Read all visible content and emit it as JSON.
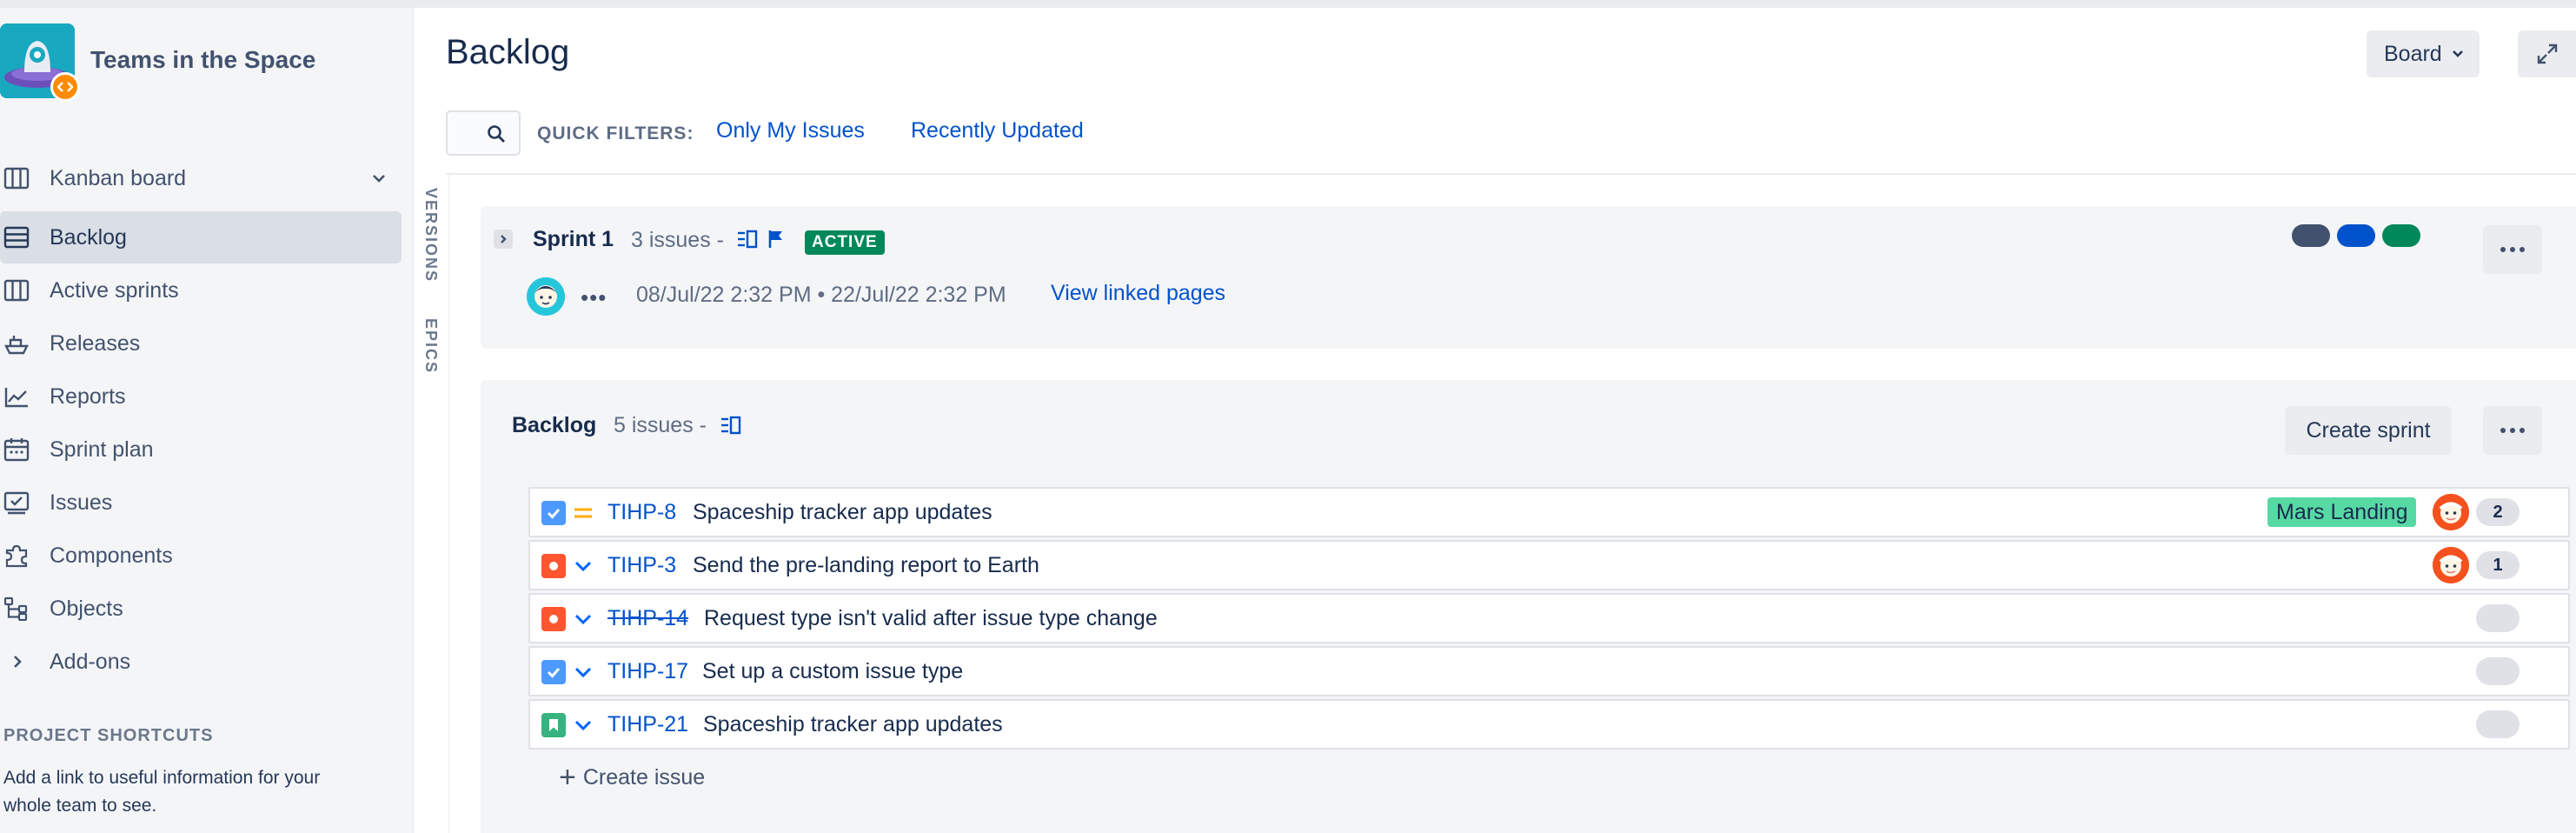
{
  "project": {
    "name": "Teams in the Space"
  },
  "nav": [
    {
      "id": "kanban-board",
      "label": "Kanban board",
      "icon": "board-icon",
      "chevron": "chevron-down-icon"
    },
    {
      "id": "backlog",
      "label": "Backlog",
      "icon": "backlog-icon",
      "active": true
    },
    {
      "id": "active-sprints",
      "label": "Active sprints",
      "icon": "columns-icon"
    },
    {
      "id": "releases",
      "label": "Releases",
      "icon": "ship-icon"
    },
    {
      "id": "reports",
      "label": "Reports",
      "icon": "graph-icon"
    },
    {
      "id": "sprint-plan",
      "label": "Sprint plan",
      "icon": "calendar-icon"
    },
    {
      "id": "issues",
      "label": "Issues",
      "icon": "issues-icon"
    },
    {
      "id": "components",
      "label": "Components",
      "icon": "puzzle-icon"
    },
    {
      "id": "objects",
      "label": "Objects",
      "icon": "hierarchy-icon"
    },
    {
      "id": "add-ons",
      "label": "Add-ons",
      "icon": "chevron-right-icon"
    }
  ],
  "shortcuts": {
    "title": "PROJECT SHORTCUTS",
    "text": "Add a link to useful information for your whole team to see."
  },
  "vtabs": {
    "versions": "VERSIONS",
    "epics": "EPICS"
  },
  "header": {
    "title": "Backlog",
    "board_button": "Board",
    "quick_filters_label": "QUICK FILTERS:",
    "filter_my_issues": "Only My Issues",
    "filter_recently_updated": "Recently Updated"
  },
  "sprint": {
    "name": "Sprint 1",
    "count": "3 issues -",
    "status": "ACTIVE",
    "dates": "08/Jul/22 2:32 PM  •  22/Jul/22 2:32 PM",
    "link": "View linked pages",
    "more": "•••",
    "status_colors": [
      "#42526E",
      "#0052CC",
      "#00875A"
    ]
  },
  "backlog": {
    "title": "Backlog",
    "count": "5 issues -",
    "create_sprint": "Create sprint",
    "create_issue": "Create issue",
    "issues": [
      {
        "type": "task",
        "type_color": "#4C9AFF",
        "priority": "medium",
        "key": "TIHP-8",
        "summary": "Spaceship tracker app updates",
        "done": false,
        "epic": "Mars Landing",
        "assignee": true,
        "points": "2"
      },
      {
        "type": "bug",
        "type_color": "#FF5630",
        "priority": "low",
        "key": "TIHP-3",
        "summary": "Send the pre-landing report to Earth",
        "done": false,
        "epic": "",
        "assignee": true,
        "points": "1"
      },
      {
        "type": "bug",
        "type_color": "#FF5630",
        "priority": "low",
        "key": "TIHP-14",
        "summary": "Request type isn't valid after issue type change",
        "done": true,
        "epic": "",
        "assignee": false,
        "points": ""
      },
      {
        "type": "task",
        "type_color": "#4C9AFF",
        "priority": "low",
        "key": "TIHP-17",
        "summary": "Set up a custom issue type",
        "done": false,
        "epic": "",
        "assignee": false,
        "points": ""
      },
      {
        "type": "story",
        "type_color": "#36B37E",
        "priority": "low",
        "key": "TIHP-21",
        "summary": "Spaceship tracker app updates",
        "done": false,
        "epic": "",
        "assignee": false,
        "points": ""
      }
    ]
  }
}
